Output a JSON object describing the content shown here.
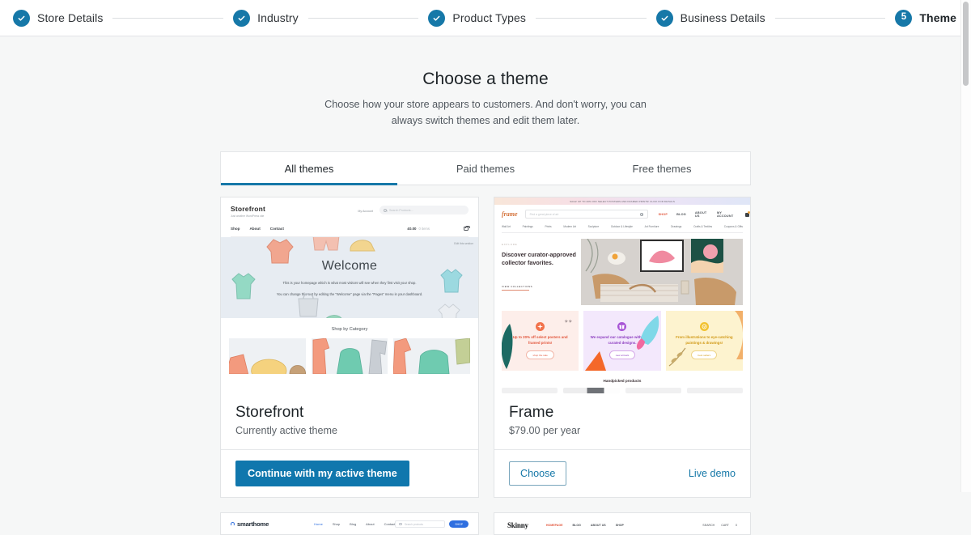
{
  "stepper": {
    "steps": [
      {
        "label": "Store Details",
        "state": "complete",
        "icon": "check-icon"
      },
      {
        "label": "Industry",
        "state": "complete",
        "icon": "check-icon"
      },
      {
        "label": "Product Types",
        "state": "complete",
        "icon": "check-icon"
      },
      {
        "label": "Business Details",
        "state": "complete",
        "icon": "check-icon"
      },
      {
        "label": "Theme",
        "state": "current",
        "number": "5"
      }
    ]
  },
  "page": {
    "title": "Choose a theme",
    "subtitle": "Choose how your store appears to customers. And don't worry, you can always switch themes and edit them later."
  },
  "tabs": [
    {
      "label": "All themes",
      "active": true
    },
    {
      "label": "Paid themes",
      "active": false
    },
    {
      "label": "Free themes",
      "active": false
    }
  ],
  "themes": [
    {
      "name": "Storefront",
      "meta": "Currently active theme",
      "primary_action": "Continue with my active theme",
      "preview": {
        "logo": "Storefront",
        "tagline": "Just another WordPress site",
        "account": "My Account",
        "search_placeholder": "Search Products…",
        "nav": [
          "Shop",
          "About",
          "Contact"
        ],
        "cart_price": "£0.00",
        "cart_items": "0 items",
        "edit_label": "Edit this section",
        "hero_title": "Welcome",
        "hero_line1": "This is your homepage which is what most visitors will see when they first visit your shop.",
        "hero_line2": "You can change this text by editing the \"Welcome\" page via the \"Pages\" menu in your dashboard.",
        "category_title": "Shop by Category"
      }
    },
    {
      "name": "Frame",
      "meta": "$79.00 per year",
      "choose_label": "Choose",
      "demo_label": "Live demo",
      "preview": {
        "banner": "SALE! UP TO 20% OFF SELECT POSTERS AND FRAMED PRINTS! CLICK FOR DETAILS",
        "logo": "frame",
        "search_placeholder": "Find a great piece of art",
        "top_nav": [
          "SHOP",
          "BLOG",
          "ABOUT US",
          "MY ACCOUNT"
        ],
        "cat_nav": [
          "Wall Art",
          "Paintings",
          "Prints",
          "Modern Art",
          "Sculpture",
          "Outdoor & Lifestyle",
          "Art Furniture",
          "Drawings",
          "Crafts & Textiles",
          "Coupons & Gifts"
        ],
        "kicker": "EXPLORE",
        "hero_heading": "Discover curator-approved collector favorites.",
        "hero_cta": "VIEW COLLECTIONS",
        "promos": [
          {
            "text": "Up to 20% off select posters and framed prints!",
            "button": "shop the sale",
            "tone": "pink",
            "icon": "flower-icon"
          },
          {
            "text": "We expand our catalogue with freshly curated designs.",
            "button": "new arrivals",
            "tone": "purple",
            "icon": "gift-icon"
          },
          {
            "text": "From illustrations to eye-catching paintings & drawings!",
            "button": "best sellers",
            "tone": "yellow",
            "icon": "medal-icon"
          }
        ],
        "handpicked_title": "Handpicked products"
      }
    },
    {
      "name": "smarthome",
      "preview": {
        "logo": "smarthome",
        "nav": [
          "Home",
          "Shop",
          "Blog",
          "About",
          "Contact"
        ],
        "search_placeholder": "Search products",
        "button": "SHOP"
      }
    },
    {
      "name": "Skinny",
      "preview": {
        "logo": "Skinny",
        "nav": [
          "HOMEPAGE",
          "BLOG",
          "ABOUT US",
          "SHOP"
        ],
        "right": [
          "SEARCH",
          "CART",
          "0"
        ]
      }
    }
  ],
  "colors": {
    "accent": "#1678a8",
    "button": "#1077ad",
    "page_bg": "#f6f7f7"
  }
}
